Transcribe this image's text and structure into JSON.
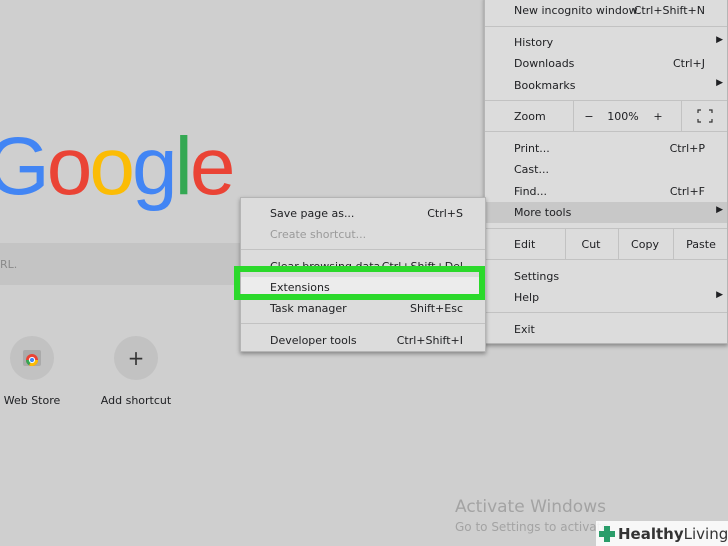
{
  "logo": {
    "letters": [
      "G",
      "o",
      "o",
      "g",
      "l",
      "e"
    ],
    "colors": [
      "#4285f4",
      "#ea4335",
      "#fbbc05",
      "#4285f4",
      "#34a853",
      "#ea4335"
    ]
  },
  "search": {
    "hint": "RL."
  },
  "shortcuts": [
    {
      "label": "Web Store"
    },
    {
      "label": "Add shortcut",
      "glyph": "+"
    }
  ],
  "main_menu": {
    "new_incognito": {
      "label": "New incognito window",
      "shortcut": "Ctrl+Shift+N"
    },
    "history": {
      "label": "History"
    },
    "downloads": {
      "label": "Downloads",
      "shortcut": "Ctrl+J"
    },
    "bookmarks": {
      "label": "Bookmarks"
    },
    "zoom": {
      "label": "Zoom",
      "minus": "−",
      "value": "100%",
      "plus": "+"
    },
    "print": {
      "label": "Print...",
      "shortcut": "Ctrl+P"
    },
    "cast": {
      "label": "Cast..."
    },
    "find": {
      "label": "Find...",
      "shortcut": "Ctrl+F"
    },
    "more_tools": {
      "label": "More tools"
    },
    "edit": {
      "label": "Edit",
      "cut": "Cut",
      "copy": "Copy",
      "paste": "Paste"
    },
    "settings": {
      "label": "Settings"
    },
    "help": {
      "label": "Help"
    },
    "exit": {
      "label": "Exit"
    }
  },
  "more_tools_menu": {
    "save_page": {
      "label": "Save page as...",
      "shortcut": "Ctrl+S"
    },
    "create_shortcut": {
      "label": "Create shortcut..."
    },
    "clear_browsing": {
      "label": "Clear browsing data...",
      "shortcut": "Ctrl+Shift+Del"
    },
    "extensions": {
      "label": "Extensions"
    },
    "task_manager": {
      "label": "Task manager",
      "shortcut": "Shift+Esc"
    },
    "developer_tools": {
      "label": "Developer tools",
      "shortcut": "Ctrl+Shift+I"
    }
  },
  "watermark": {
    "title": "Activate Windows",
    "subtitle": "Go to Settings to activate"
  },
  "brand": {
    "part1": "Healthy",
    "part2": "Living"
  }
}
